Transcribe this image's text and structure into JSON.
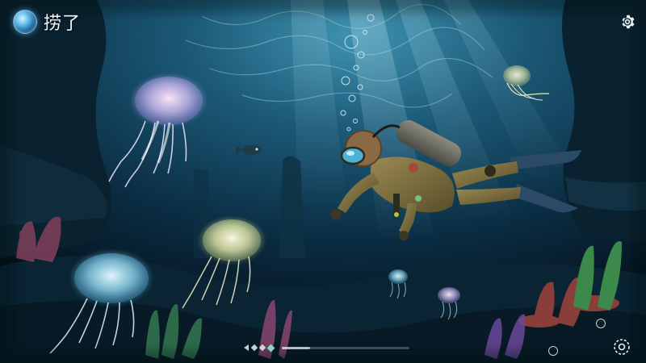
{
  "hud": {
    "title": "捞了",
    "orb_icon": "orb-icon",
    "settings_icon": "gear-icon",
    "corner_icon": "gear-dashed-icon"
  },
  "bottom_nav": {
    "progress": 0.22,
    "active_index": 2
  },
  "colors": {
    "water_deep": "#04121c",
    "water_mid": "#0d3a52",
    "water_light": "#2a7a9a",
    "jellyfish": "#cfe6ff",
    "diver_suit": "#7a6a3c",
    "accent_green": "#7ee0b0"
  }
}
